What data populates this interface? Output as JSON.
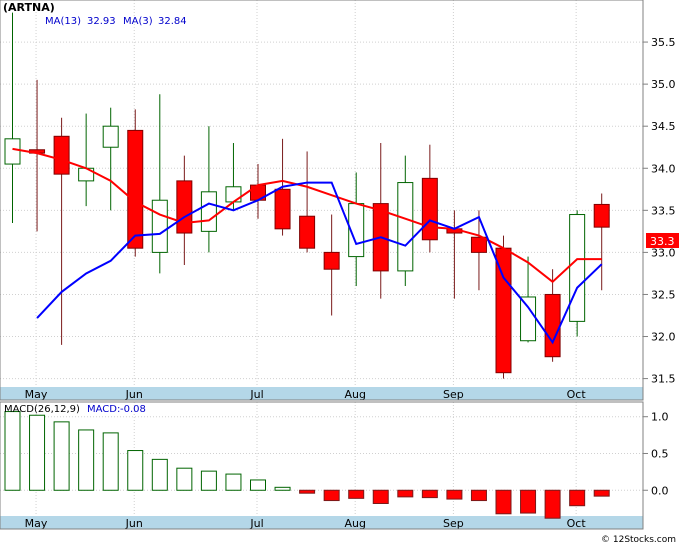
{
  "chart_data": [
    {
      "type": "candlestick",
      "title": "(ARTNA)",
      "legend": [
        {
          "label": "MA(13)",
          "value": "32.93",
          "color": "#ff0000"
        },
        {
          "label": "MA(3)",
          "value": "32.84",
          "color": "#0000ff"
        }
      ],
      "ylim": [
        31.4,
        36.0
      ],
      "yticks": [
        "31.5",
        "32.0",
        "32.5",
        "33.0",
        "33.5",
        "34.0",
        "34.5",
        "35.0",
        "35.5"
      ],
      "xlabels": [
        "May",
        "Jun",
        "Jul",
        "Aug",
        "Sep",
        "Oct"
      ],
      "last_price": "33.3",
      "colors": {
        "up_body": "#ffffff",
        "up_border": "#006400",
        "down_body": "#ff0000",
        "ma13": "#ff0000",
        "ma3": "#0000ff",
        "last_price_bg": "#ff0000"
      },
      "candles": [
        {
          "o": 34.05,
          "h": 35.85,
          "l": 33.35,
          "c": 34.35
        },
        {
          "o": 34.22,
          "h": 35.05,
          "l": 33.25,
          "c": 34.18
        },
        {
          "o": 34.38,
          "h": 34.6,
          "l": 31.9,
          "c": 33.93
        },
        {
          "o": 33.85,
          "h": 34.65,
          "l": 33.55,
          "c": 34.0
        },
        {
          "o": 34.25,
          "h": 34.72,
          "l": 33.5,
          "c": 34.5
        },
        {
          "o": 34.45,
          "h": 34.7,
          "l": 32.95,
          "c": 33.05
        },
        {
          "o": 33.0,
          "h": 34.88,
          "l": 32.75,
          "c": 33.62
        },
        {
          "o": 33.85,
          "h": 34.15,
          "l": 32.85,
          "c": 33.23
        },
        {
          "o": 33.25,
          "h": 34.5,
          "l": 33.0,
          "c": 33.72
        },
        {
          "o": 33.6,
          "h": 34.3,
          "l": 33.5,
          "c": 33.78
        },
        {
          "o": 33.8,
          "h": 34.05,
          "l": 33.4,
          "c": 33.62
        },
        {
          "o": 33.75,
          "h": 34.35,
          "l": 33.2,
          "c": 33.28
        },
        {
          "o": 33.43,
          "h": 34.2,
          "l": 33.0,
          "c": 33.05
        },
        {
          "o": 33.0,
          "h": 33.45,
          "l": 32.25,
          "c": 32.8
        },
        {
          "o": 32.95,
          "h": 33.95,
          "l": 32.6,
          "c": 33.58
        },
        {
          "o": 33.58,
          "h": 34.3,
          "l": 32.45,
          "c": 32.78
        },
        {
          "o": 32.78,
          "h": 34.15,
          "l": 32.6,
          "c": 33.83
        },
        {
          "o": 33.88,
          "h": 34.28,
          "l": 33.0,
          "c": 33.15
        },
        {
          "o": 33.28,
          "h": 33.5,
          "l": 32.45,
          "c": 33.23
        },
        {
          "o": 33.18,
          "h": 33.5,
          "l": 32.55,
          "c": 33.0
        },
        {
          "o": 33.05,
          "h": 33.2,
          "l": 31.5,
          "c": 31.57
        },
        {
          "o": 31.95,
          "h": 32.95,
          "l": 31.93,
          "c": 32.47
        },
        {
          "o": 32.5,
          "h": 32.8,
          "l": 31.7,
          "c": 31.76
        },
        {
          "o": 32.18,
          "h": 33.5,
          "l": 32.0,
          "c": 33.45
        },
        {
          "o": 33.57,
          "h": 33.7,
          "l": 32.55,
          "c": 33.3
        }
      ],
      "ma13": [
        34.23,
        34.18,
        34.1,
        34.0,
        33.85,
        33.6,
        33.45,
        33.35,
        33.38,
        33.6,
        33.8,
        33.85,
        33.78,
        33.68,
        33.58,
        33.5,
        33.4,
        33.3,
        33.28,
        33.2,
        33.05,
        32.88,
        32.65,
        32.92,
        32.92
      ],
      "ma3": [
        32.22,
        32.53,
        32.75,
        32.9,
        33.2,
        33.22,
        33.42,
        33.58,
        33.5,
        33.62,
        33.78,
        33.83,
        33.83,
        33.1,
        33.18,
        33.08,
        33.38,
        33.28,
        33.42,
        32.7,
        32.35,
        31.93,
        32.58,
        32.86
      ],
      "ma3_start": 1
    },
    {
      "type": "bar",
      "title": "MACD(26,12,9)",
      "legend": [
        {
          "label": "MACD:",
          "value": "-0.08",
          "color": "#0000ff"
        }
      ],
      "ylim": [
        -0.35,
        1.2
      ],
      "yticks": [
        "0.0",
        "0.5",
        "1.0"
      ],
      "xlabels": [
        "May",
        "Jun",
        "Jul",
        "Aug",
        "Sep",
        "Oct"
      ],
      "values": [
        1.07,
        1.02,
        0.93,
        0.82,
        0.78,
        0.54,
        0.42,
        0.3,
        0.26,
        0.22,
        0.14,
        0.04,
        -0.04,
        -0.14,
        -0.11,
        -0.18,
        -0.09,
        -0.1,
        -0.12,
        -0.14,
        -0.32,
        -0.31,
        -0.38,
        -0.21,
        -0.08
      ],
      "colors": {
        "positive": "#006400",
        "negative": "#ff0000"
      }
    }
  ],
  "watermark": "© 12Stocks.com"
}
